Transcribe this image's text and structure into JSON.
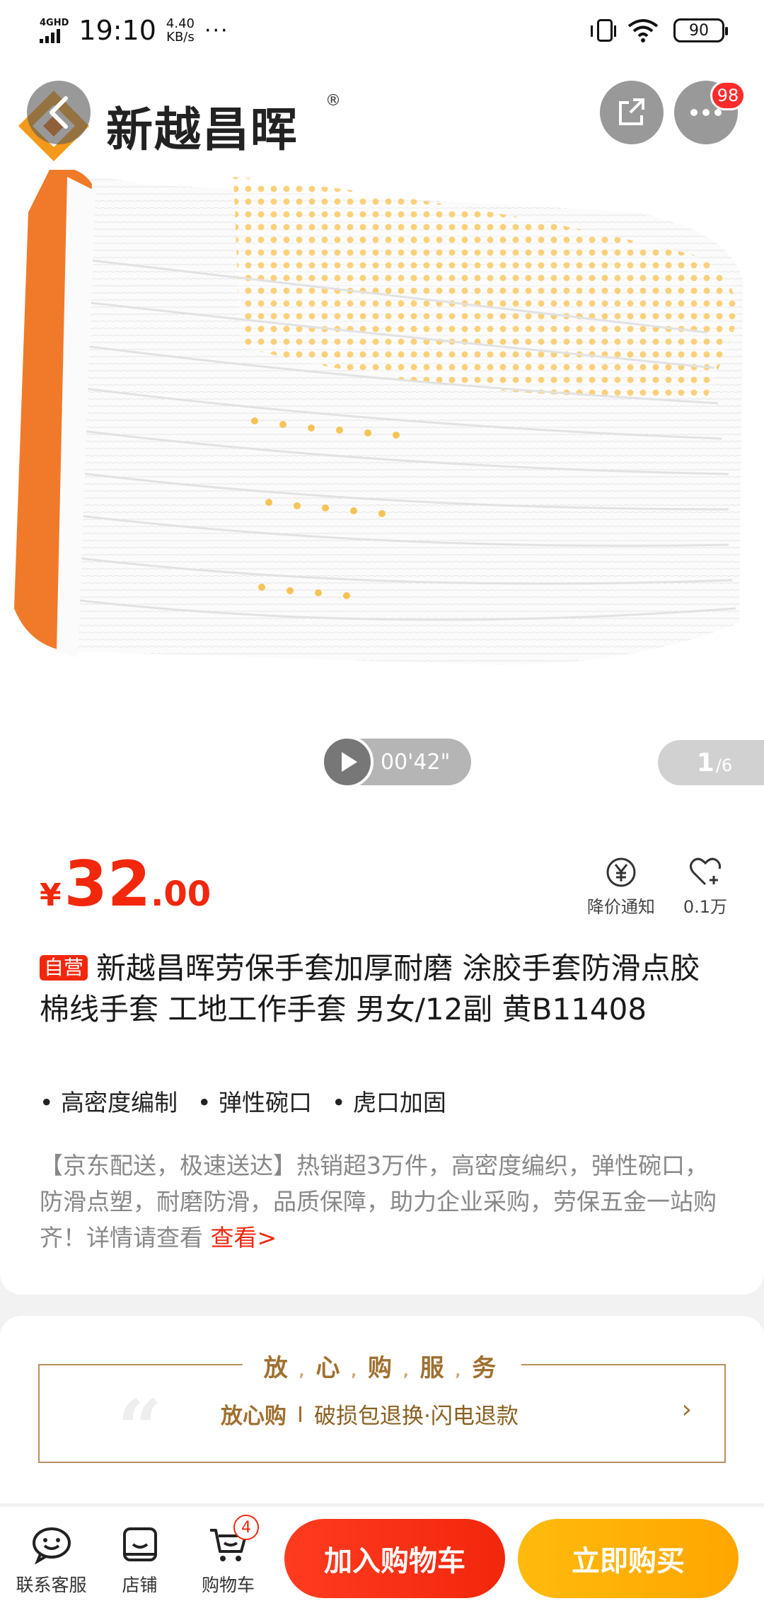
{
  "status_bar": {
    "network": "4GHD",
    "time": "19:10",
    "speed_value": "4.40",
    "speed_unit": "KB/s",
    "more": "···",
    "battery": "90"
  },
  "header": {
    "back_icon": "chevron-left-icon",
    "share_icon": "share-icon",
    "more_icon": "more-icon",
    "message_badge": "98"
  },
  "hero": {
    "brand_name": "新越昌晖",
    "brand_reg": "®",
    "video_duration": "00'42\"",
    "image_index": "1",
    "image_total": "/6"
  },
  "product": {
    "currency": "¥",
    "price_int": "32",
    "price_dec": ".00",
    "price_alert_label": "降价通知",
    "favorite_count": "0.1万",
    "self_tag": "自营",
    "title": "新越昌晖劳保手套加厚耐磨 涂胶手套防滑点胶棉线手套 工地工作手套 男女/12副 黄B11408",
    "features": [
      "高密度编制",
      "弹性碗口",
      "虎口加固"
    ],
    "description": "【京东配送，极速送达】热销超3万件，高密度编织，弹性碗口，防滑点塑，耐磨防滑，品质保障，助力企业采购，劳保五金一站购齐！详情请查看 ",
    "description_link": "查看>"
  },
  "service": {
    "title_chars": [
      "放",
      "心",
      "购",
      "服",
      "务"
    ],
    "label": "放心购",
    "detail": "破损包退换·闪电退款",
    "arrow": "›",
    "quote_mark": "“"
  },
  "bottom_bar": {
    "customer_service": "联系客服",
    "store": "店铺",
    "cart": "购物车",
    "cart_count": "4",
    "add_to_cart": "加入购物车",
    "buy_now": "立即购买"
  },
  "colors": {
    "price_red": "#f2270c",
    "buy_orange": "#ffa600",
    "service_gold": "#a07030",
    "glove_orange": "#f07a2a",
    "dots_yellow": "#f6b21f"
  }
}
